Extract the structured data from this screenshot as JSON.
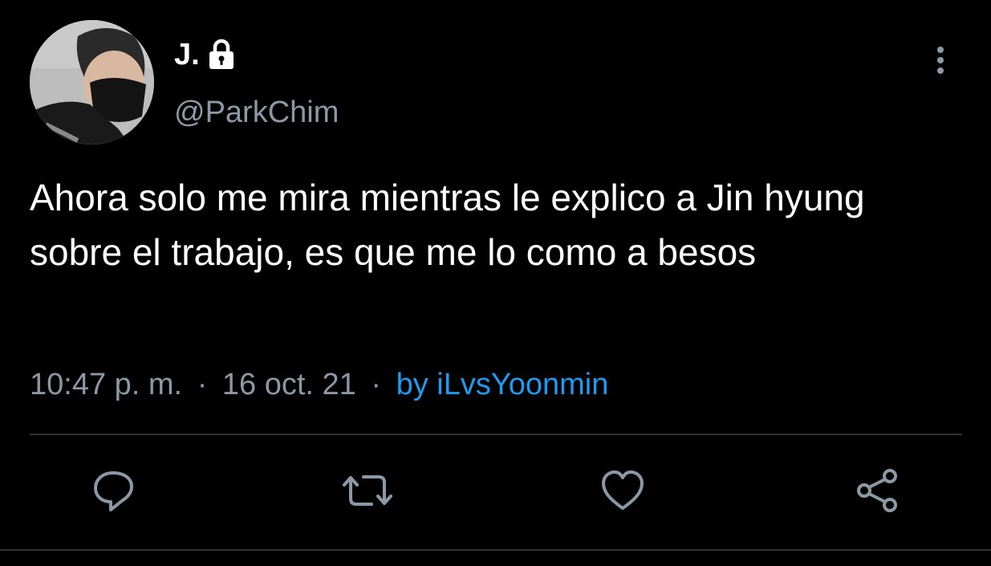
{
  "tweet": {
    "display_name": "J.",
    "handle": "@ParkChim",
    "text": "Ahora solo me mira mientras le explico a Jin hyung sobre el trabajo, es que me lo como a besos",
    "time": "10:47 p. m.",
    "date": "16 oct. 21",
    "separator": "·",
    "via": "by iLvsYoonmin"
  },
  "icons": {
    "lock": "lock-icon",
    "more": "more-vertical-icon",
    "reply": "reply-icon",
    "retweet": "retweet-icon",
    "like": "heart-icon",
    "share": "share-icon"
  },
  "colors": {
    "background": "#000000",
    "text": "#ffffff",
    "muted": "#8b98a5",
    "accent": "#1d9bf0",
    "divider": "#2f3336"
  }
}
